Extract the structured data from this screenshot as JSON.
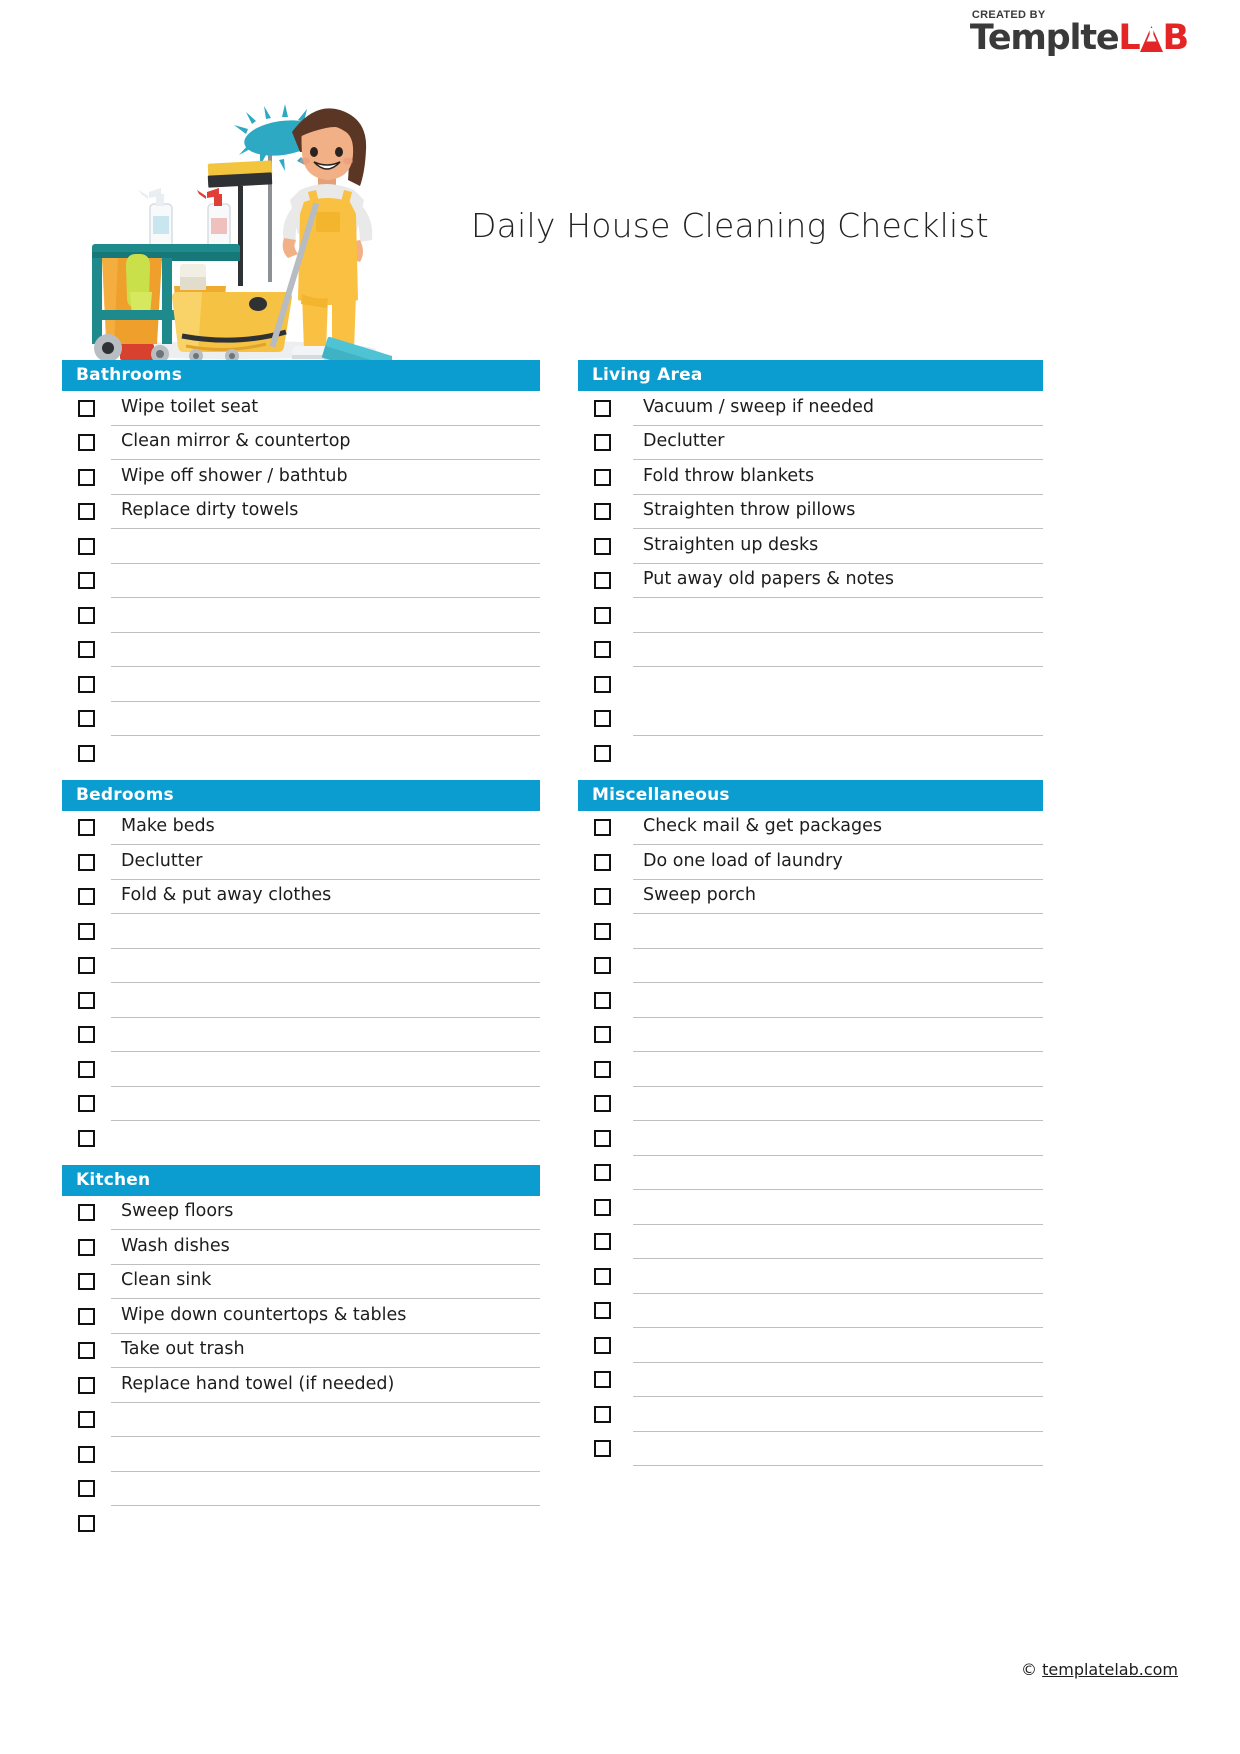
{
  "brand": {
    "created_by": "CREATED BY",
    "name_dark": "Templ",
    "name_dark_tail": "te",
    "flask_letter": "A",
    "name_red_l": "L",
    "name_red_b": "B",
    "color_dark": "#3a3a3a",
    "color_red": "#e32526"
  },
  "title": "Daily House Cleaning Checklist",
  "theme": {
    "header_blue": "#0b9dd0",
    "rule_gray": "#bfbfbf",
    "text": "#1d1d1d"
  },
  "illustration": {
    "name": "cleaning-woman-with-cart-illustration",
    "colors": {
      "overalls": "#f9c041",
      "skin": "#f2b087",
      "hair": "#5b3624",
      "cart": "#1f8a8c",
      "bucket": "#f0a92b",
      "mop": "#4ec3d4",
      "shirt": "#e9e9ea"
    }
  },
  "columns": {
    "left": [
      {
        "id": "bathrooms",
        "header": "Bathrooms",
        "rows": [
          {
            "text": "Wipe toilet seat",
            "rule": true
          },
          {
            "text": "Clean mirror & countertop",
            "rule": true
          },
          {
            "text": "Wipe off shower / bathtub",
            "rule": true
          },
          {
            "text": "Replace dirty towels",
            "rule": true
          },
          {
            "text": "",
            "rule": true
          },
          {
            "text": "",
            "rule": true
          },
          {
            "text": "",
            "rule": true
          },
          {
            "text": "",
            "rule": true
          },
          {
            "text": "",
            "rule": true
          },
          {
            "text": "",
            "rule": true
          },
          {
            "text": "",
            "rule": false
          }
        ]
      },
      {
        "id": "bedrooms",
        "header": "Bedrooms",
        "rows": [
          {
            "text": "Make beds",
            "rule": true
          },
          {
            "text": "Declutter",
            "rule": true
          },
          {
            "text": "Fold & put away clothes",
            "rule": true
          },
          {
            "text": "",
            "rule": true
          },
          {
            "text": "",
            "rule": true
          },
          {
            "text": "",
            "rule": true
          },
          {
            "text": "",
            "rule": true
          },
          {
            "text": "",
            "rule": true
          },
          {
            "text": "",
            "rule": true
          },
          {
            "text": "",
            "rule": false
          }
        ]
      },
      {
        "id": "kitchen",
        "header": "Kitchen",
        "rows": [
          {
            "text": "Sweep floors",
            "rule": true
          },
          {
            "text": "Wash dishes",
            "rule": true
          },
          {
            "text": "Clean sink",
            "rule": true
          },
          {
            "text": "Wipe down countertops & tables",
            "rule": true
          },
          {
            "text": "Take out trash",
            "rule": true
          },
          {
            "text": "Replace hand towel (if needed)",
            "rule": true
          },
          {
            "text": "",
            "rule": true
          },
          {
            "text": "",
            "rule": true
          },
          {
            "text": "",
            "rule": true
          },
          {
            "text": "",
            "rule": false
          }
        ]
      }
    ],
    "right": [
      {
        "id": "living-area",
        "header": "Living Area",
        "rows": [
          {
            "text": "Vacuum / sweep if needed",
            "rule": true
          },
          {
            "text": "Declutter",
            "rule": true
          },
          {
            "text": "Fold throw blankets",
            "rule": true
          },
          {
            "text": "Straighten throw pillows",
            "rule": true
          },
          {
            "text": "Straighten up desks",
            "rule": true
          },
          {
            "text": "Put away old papers & notes",
            "rule": true
          },
          {
            "text": "",
            "rule": true
          },
          {
            "text": "",
            "rule": true
          },
          {
            "text": "",
            "rule": false
          },
          {
            "text": "",
            "rule": true
          },
          {
            "text": "",
            "rule": false
          }
        ]
      },
      {
        "id": "miscellaneous",
        "header": "Miscellaneous",
        "rows": [
          {
            "text": "Check mail & get packages",
            "rule": true
          },
          {
            "text": "Do one load of laundry",
            "rule": true
          },
          {
            "text": "Sweep porch",
            "rule": true
          },
          {
            "text": "",
            "rule": true
          },
          {
            "text": "",
            "rule": true
          },
          {
            "text": "",
            "rule": true
          },
          {
            "text": "",
            "rule": true
          },
          {
            "text": "",
            "rule": true
          },
          {
            "text": "",
            "rule": true
          },
          {
            "text": "",
            "rule": true
          },
          {
            "text": "",
            "rule": true
          },
          {
            "text": "",
            "rule": true
          },
          {
            "text": "",
            "rule": true
          },
          {
            "text": "",
            "rule": true
          },
          {
            "text": "",
            "rule": true
          },
          {
            "text": "",
            "rule": true
          },
          {
            "text": "",
            "rule": true
          },
          {
            "text": "",
            "rule": true
          },
          {
            "text": "",
            "rule": true
          }
        ]
      }
    ]
  },
  "footer": {
    "copyright_symbol": "©",
    "url": "templatelab.com"
  }
}
